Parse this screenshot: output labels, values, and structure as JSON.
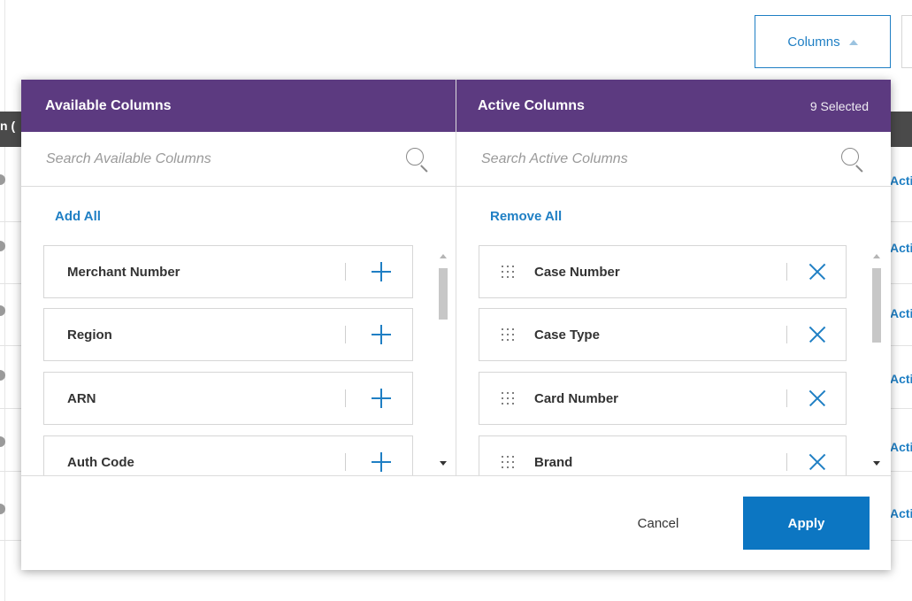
{
  "toolbar": {
    "columns_label": "Columns",
    "caret_icon": "caret-up-icon"
  },
  "background_table": {
    "header_fragment": "n (",
    "row_action": "Acti"
  },
  "available": {
    "title": "Available Columns",
    "search_placeholder": "Search Available Columns",
    "add_all_label": "Add All",
    "items": [
      {
        "label": "Merchant Number",
        "icon": "plus-icon"
      },
      {
        "label": "Region",
        "icon": "plus-icon"
      },
      {
        "label": "ARN",
        "icon": "plus-icon"
      },
      {
        "label": "Auth Code",
        "icon": "plus-icon"
      }
    ]
  },
  "active": {
    "title": "Active Columns",
    "selected_count": "9 Selected",
    "search_placeholder": "Search Active Columns",
    "remove_all_label": "Remove All",
    "items": [
      {
        "label": "Case Number",
        "icon": "close-icon"
      },
      {
        "label": "Case Type",
        "icon": "close-icon"
      },
      {
        "label": "Card Number",
        "icon": "close-icon"
      },
      {
        "label": "Brand",
        "icon": "close-icon"
      }
    ]
  },
  "footer": {
    "cancel_label": "Cancel",
    "apply_label": "Apply"
  },
  "colors": {
    "header_purple": "#5c3a80",
    "accent_blue": "#1f7fc4",
    "apply_blue": "#0c76c2"
  }
}
